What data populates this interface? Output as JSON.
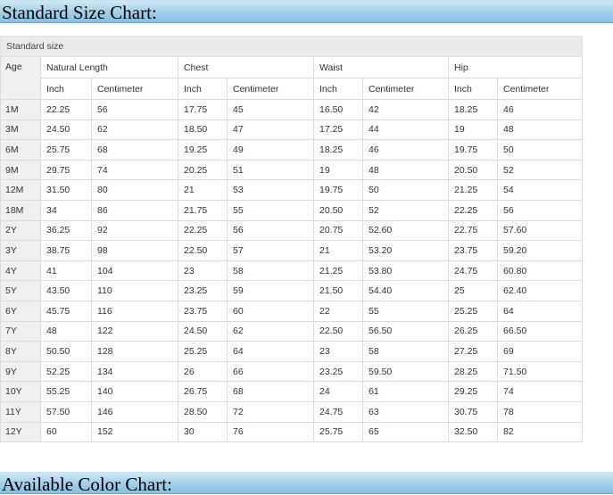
{
  "header_title": "Standard Size Chart:",
  "footer_title": "Available Color Chart:",
  "table": {
    "caption": "Standard size",
    "age_label": "Age",
    "groups": [
      "Natural Length",
      "Chest",
      "Waist",
      "Hip"
    ],
    "sub_headers": [
      "Inch",
      "Centimeter",
      "Inch",
      "Centimeter",
      "Inch",
      "Centimeter",
      "Inch",
      "Centimeter"
    ],
    "rows": [
      [
        "1M",
        "22.25",
        "56",
        "17.75",
        "45",
        "16.50",
        "42",
        "18.25",
        "46"
      ],
      [
        "3M",
        "24.50",
        "62",
        "18.50",
        "47",
        "17.25",
        "44",
        "19",
        "48"
      ],
      [
        "6M",
        "25.75",
        "68",
        "19.25",
        "49",
        "18.25",
        "46",
        "19.75",
        "50"
      ],
      [
        "9M",
        "29.75",
        "74",
        "20.25",
        "51",
        "19",
        "48",
        "20.50",
        "52"
      ],
      [
        "12M",
        "31.50",
        "80",
        "21",
        "53",
        "19.75",
        "50",
        "21.25",
        "54"
      ],
      [
        "18M",
        "34",
        "86",
        "21.75",
        "55",
        "20.50",
        "52",
        "22.25",
        "56"
      ],
      [
        "2Y",
        "36.25",
        "92",
        "22.25",
        "56",
        "20.75",
        "52.60",
        "22.75",
        "57.60"
      ],
      [
        "3Y",
        "38.75",
        "98",
        "22.50",
        "57",
        "21",
        "53.20",
        "23.75",
        "59.20"
      ],
      [
        "4Y",
        "41",
        "104",
        "23",
        "58",
        "21.25",
        "53.80",
        "24.75",
        "60.80"
      ],
      [
        "5Y",
        "43.50",
        "110",
        "23.25",
        "59",
        "21.50",
        "54.40",
        "25",
        "62.40"
      ],
      [
        "6Y",
        "45.75",
        "116",
        "23.75",
        "60",
        "22",
        "55",
        "25.25",
        "64"
      ],
      [
        "7Y",
        "48",
        "122",
        "24.50",
        "62",
        "22.50",
        "56.50",
        "26.25",
        "66.50"
      ],
      [
        "8Y",
        "50.50",
        "128",
        "25.25",
        "64",
        "23",
        "58",
        "27.25",
        "69"
      ],
      [
        "9Y",
        "52.25",
        "134",
        "26",
        "66",
        "23.25",
        "59.50",
        "28.25",
        "71.50"
      ],
      [
        "10Y",
        "55.25",
        "140",
        "26.75",
        "68",
        "24",
        "61",
        "29.25",
        "74"
      ],
      [
        "11Y",
        "57.50",
        "146",
        "28.50",
        "72",
        "24.75",
        "63",
        "30.75",
        "78"
      ],
      [
        "12Y",
        "60",
        "152",
        "30",
        "76",
        "25.75",
        "65",
        "32.50",
        "82"
      ]
    ]
  }
}
